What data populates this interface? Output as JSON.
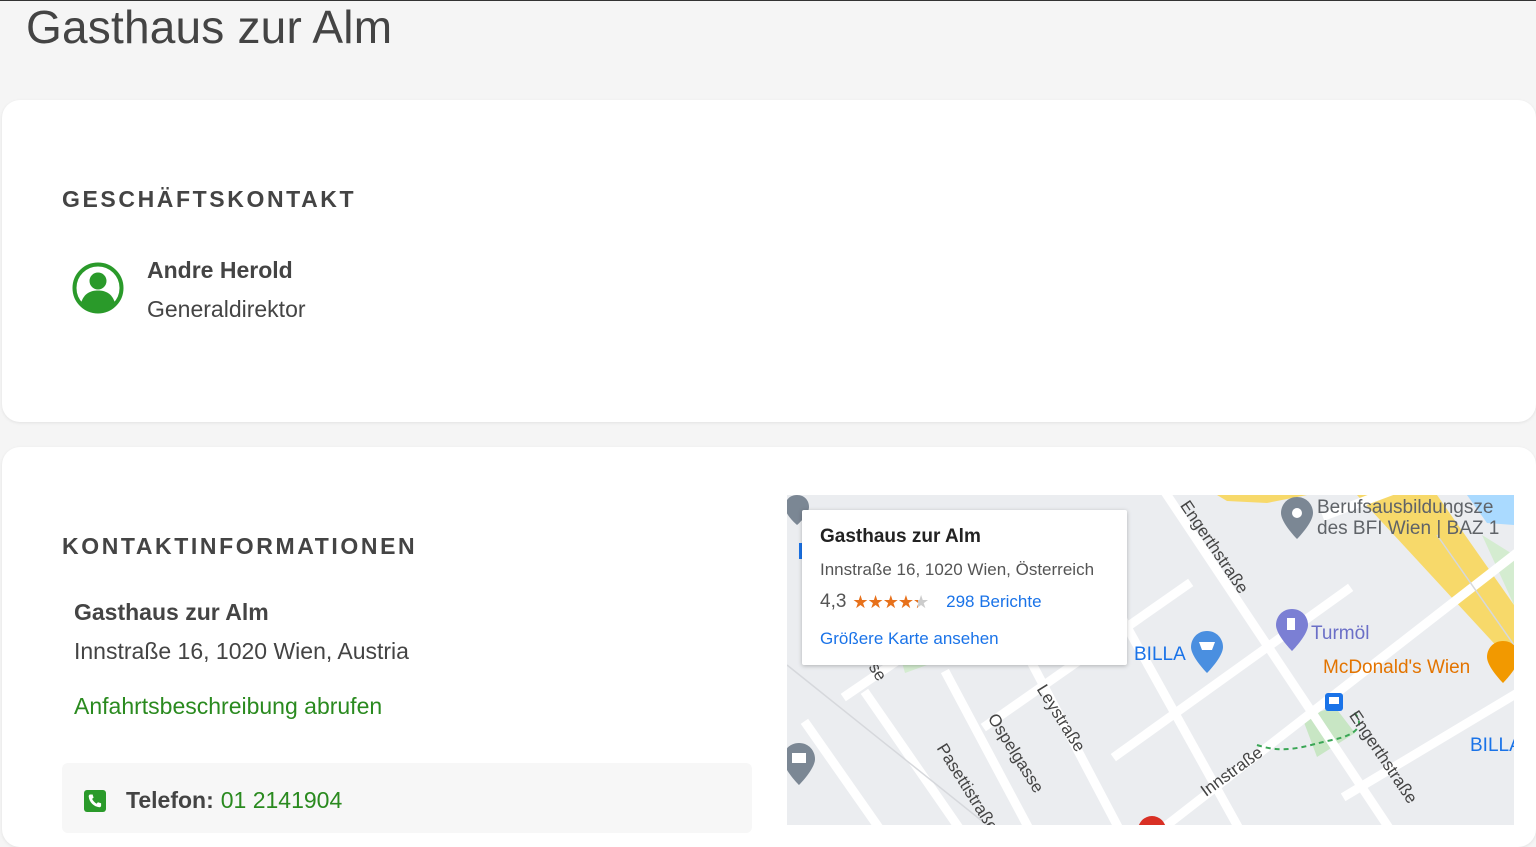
{
  "page": {
    "title": "Gasthaus zur Alm"
  },
  "contact_card": {
    "heading": "GESCHÄFTSKONTAKT",
    "person": {
      "name": "Andre Herold",
      "role": "Generaldirektor",
      "icon": "user-circle-icon"
    }
  },
  "info_card": {
    "heading": "KONTAKTINFORMATIONEN",
    "business_name": "Gasthaus zur Alm",
    "address": "Innstraße 16, 1020 Wien, Austria",
    "directions_label": "Anfahrtsbeschreibung abrufen",
    "phone": {
      "label": "Telefon:",
      "number": "01 2141904",
      "icon": "phone-icon"
    }
  },
  "map": {
    "popup": {
      "title": "Gasthaus zur Alm",
      "address": "Innstraße 16, 1020 Wien, Österreich",
      "rating": "4,3",
      "stars": 4.3,
      "reviews": "298 Berichte",
      "larger_map": "Größere Karte ansehen"
    },
    "places": {
      "bfi_line1": "Berufsausbildungsze",
      "bfi_line2": "des BFI Wien | BAZ 1",
      "turmoel": "Turmöl",
      "mcdonalds": "McDonald's Wien",
      "billa": "BILLA",
      "billa2": "BILLA"
    },
    "streets": {
      "engerth1": "Engerthstraße",
      "engerth2": "Engerthstraße",
      "ley": "Leystraße",
      "ospel": "Ospelgasse",
      "pasetti": "Pasettistraße",
      "inn": "Innstraße",
      "partial": "se"
    },
    "colors": {
      "link": "#1a73e8",
      "star": "#e7711b",
      "brand_green": "#2a8a1f"
    }
  }
}
